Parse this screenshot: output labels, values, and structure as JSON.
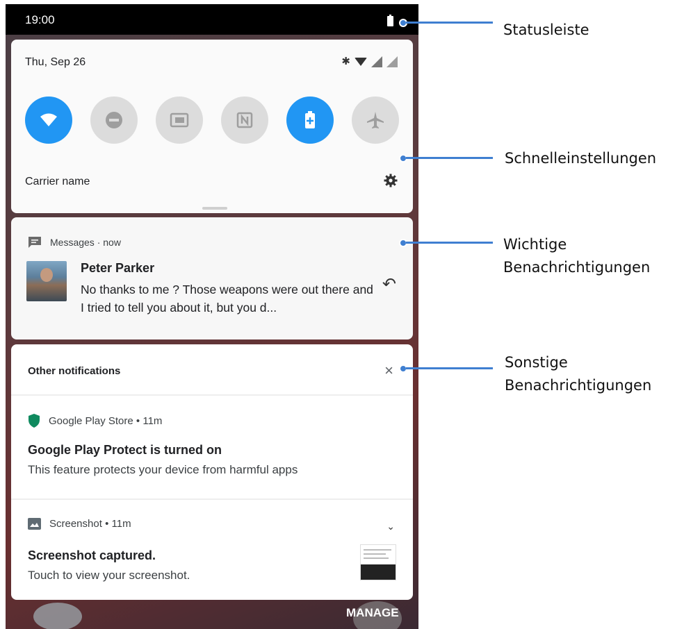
{
  "status_bar": {
    "time": "19:00",
    "battery_icon": "battery-icon"
  },
  "quick_settings": {
    "date": "Thu, Sep 26",
    "status_icons": [
      "bluetooth-icon",
      "wifi-icon",
      "signal-icon",
      "signal-icon"
    ],
    "tiles": [
      {
        "name": "wifi",
        "icon": "wifi-icon",
        "active": true
      },
      {
        "name": "do-not-disturb",
        "icon": "do-not-disturb-icon",
        "active": false
      },
      {
        "name": "cast",
        "icon": "cast-icon",
        "active": false
      },
      {
        "name": "nfc",
        "icon": "nfc-icon",
        "active": false
      },
      {
        "name": "battery-saver",
        "icon": "battery-saver-icon",
        "active": true
      },
      {
        "name": "airplane-mode",
        "icon": "airplane-icon",
        "active": false
      }
    ],
    "carrier": "Carrier name",
    "settings_icon": "gear-icon"
  },
  "messages_notification": {
    "app": "Messages",
    "separator": "·",
    "time": "now",
    "sender": "Peter Parker",
    "body": "No thanks to me ? Those weapons were out there and I tried  to  tell you about it, but you d...",
    "reply_icon": "reply-icon"
  },
  "other_notifications": {
    "title": "Other notifications",
    "close_glyph": "×",
    "items": [
      {
        "app": "Google Play Store",
        "separator": "•",
        "time": "11m",
        "title": "Google Play Protect is turned on",
        "text": "This feature protects your device from harmful apps"
      },
      {
        "app": "Screenshot",
        "separator": "•",
        "time": "11m",
        "title": "Screenshot captured.",
        "text": "Touch to view your screenshot."
      }
    ]
  },
  "bottom": {
    "manage_label": "MANAGE"
  },
  "annotations": {
    "status_bar": "Statusleiste",
    "quick_settings": "Schnelleinstellungen",
    "important_line1": "Wichtige",
    "important_line2": "Benachrichtigungen",
    "other_line1": "Sonstige",
    "other_line2": "Benachrichtigungen"
  },
  "colors": {
    "accent": "#2196f3",
    "annotation": "#3f7fd1",
    "status_bar": "#000000"
  }
}
